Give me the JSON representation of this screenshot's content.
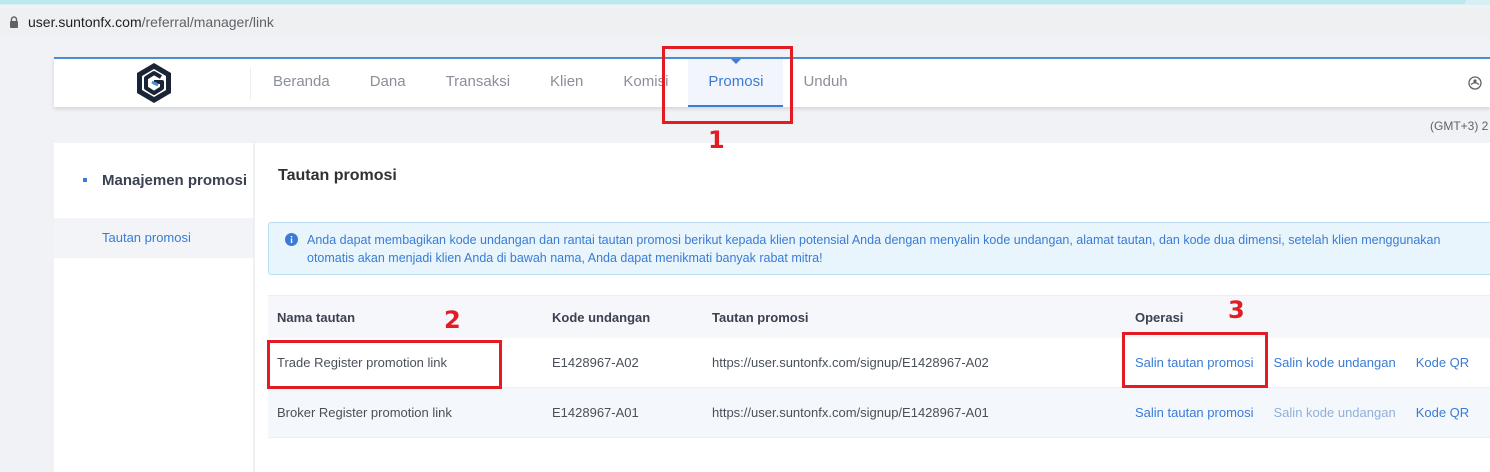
{
  "browser": {
    "url_host": "user.suntonfx.com",
    "url_path": "/referral/manager/link"
  },
  "nav": {
    "items": [
      {
        "label": "Beranda"
      },
      {
        "label": "Dana"
      },
      {
        "label": "Transaksi"
      },
      {
        "label": "Klien"
      },
      {
        "label": "Komisi"
      },
      {
        "label": "Promosi",
        "active": true
      },
      {
        "label": "Unduh"
      }
    ]
  },
  "header": {
    "timezone": "(GMT+3) 2"
  },
  "sidebar": {
    "group_label": "Manajemen promosi",
    "items": [
      {
        "label": "Tautan promosi"
      }
    ]
  },
  "main": {
    "title": "Tautan promosi",
    "info_line1": "Anda dapat membagikan kode undangan dan rantai tautan promosi berikut kepada klien potensial Anda dengan menyalin kode undangan, alamat tautan, dan kode dua dimensi, setelah klien menggunakan",
    "info_line2": "otomatis akan menjadi klien Anda di bawah nama, Anda dapat menikmati banyak rabat mitra!",
    "table": {
      "headers": [
        "Nama tautan",
        "Kode undangan",
        "Tautan promosi",
        "Operasi"
      ],
      "rows": [
        {
          "name": "Trade Register promotion link",
          "code": "E1428967-A02",
          "link": "https://user.suntonfx.com/signup/E1428967-A02",
          "op_copy_link": "Salin tautan promosi",
          "op_copy_code": "Salin kode undangan",
          "op_qr": "Kode QR"
        },
        {
          "name": "Broker Register promotion link",
          "code": "E1428967-A01",
          "link": "https://user.suntonfx.com/signup/E1428967-A01",
          "op_copy_link": "Salin tautan promosi",
          "op_copy_code": "Salin kode undangan",
          "op_qr": "Kode QR"
        }
      ]
    }
  },
  "annotations": {
    "n1": "1",
    "n2": "2",
    "n3": "3"
  },
  "colors": {
    "accent": "#3a7bd5",
    "annotation": "#e31b23"
  }
}
